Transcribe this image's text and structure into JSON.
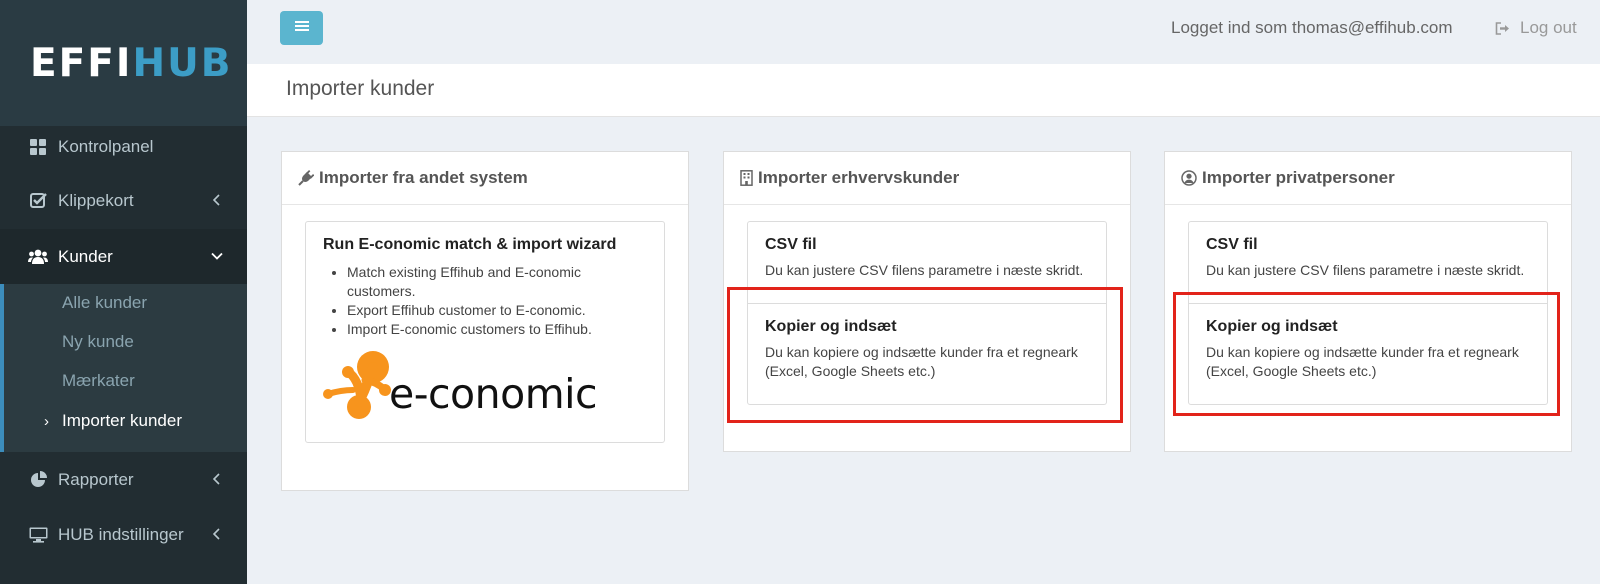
{
  "brand": {
    "part1": "EFFI",
    "part2": "HUB"
  },
  "sidebar": {
    "items": [
      {
        "label": "Kontrolpanel",
        "icon": "dashboard-icon"
      },
      {
        "label": "Klippekort",
        "icon": "check-square-icon"
      },
      {
        "label": "Kunder",
        "icon": "users-icon"
      },
      {
        "label": "Rapporter",
        "icon": "pie-chart-icon"
      },
      {
        "label": "HUB indstillinger",
        "icon": "monitor-icon"
      }
    ],
    "submenu": [
      {
        "label": "Alle kunder"
      },
      {
        "label": "Ny kunde"
      },
      {
        "label": "Mærkater"
      },
      {
        "label": "Importer kunder"
      }
    ]
  },
  "header": {
    "user_text": "Logget ind som thomas@effihub.com",
    "logout_label": "Log out"
  },
  "page": {
    "title": "Importer kunder"
  },
  "boxes": [
    {
      "title": "Importer fra andet system",
      "icon": "plug-icon",
      "card": {
        "title": "Run E-conomic match & import wizard",
        "bullets": [
          "Match existing Effihub and E-conomic customers.",
          "Export Effihub customer to E-conomic.",
          "Import E-conomic customers to Effihub."
        ],
        "logo_text": "e-conomic"
      }
    },
    {
      "title": "Importer erhvervskunder",
      "icon": "building-icon",
      "options": [
        {
          "title": "CSV fil",
          "text": "Du kan justere CSV filens parametre i næste skridt."
        },
        {
          "title": "Kopier og indsæt",
          "text": "Du kan kopiere og indsætte kunder fra et regneark (Excel, Google Sheets etc.)"
        }
      ]
    },
    {
      "title": "Importer privatpersoner",
      "icon": "user-circle-icon",
      "options": [
        {
          "title": "CSV fil",
          "text": "Du kan justere CSV filens parametre i næste skridt."
        },
        {
          "title": "Kopier og indsæt",
          "text": "Du kan kopiere og indsætte kunder fra et regneark (Excel, Google Sheets etc.)"
        }
      ]
    }
  ],
  "colors": {
    "sidebar_bg": "#222d32",
    "accent": "#3c8dbc",
    "brand_blue": "#3c9dc6",
    "menu_button": "#5bb5cf",
    "highlight_red": "#e2231a",
    "economic_orange": "#f7941d"
  }
}
